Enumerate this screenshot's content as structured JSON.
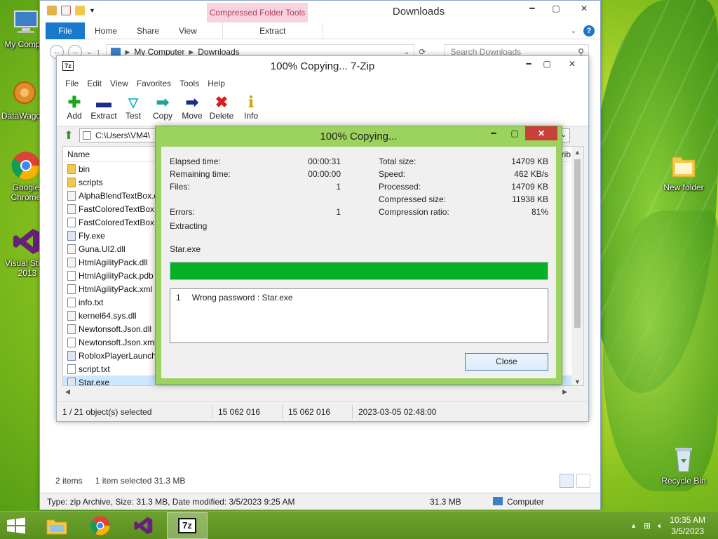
{
  "desktop": {
    "icons": [
      {
        "label": "My Comp..."
      },
      {
        "label": "DataWago..."
      },
      {
        "label": "Google Chrome"
      },
      {
        "label": "Visual Stu... 2013"
      },
      {
        "label": "New folder"
      },
      {
        "label": "Recycle Bin"
      }
    ]
  },
  "explorer": {
    "title": "Downloads",
    "context_tab": "Compressed Folder Tools",
    "tabs": {
      "file": "File",
      "home": "Home",
      "share": "Share",
      "view": "View",
      "extract": "Extract"
    },
    "breadcrumb": {
      "root": "My Computer",
      "folder": "Downloads"
    },
    "search_placeholder": "Search Downloads",
    "status": {
      "items": "2 items",
      "selected": "1 item selected  31.3 MB"
    },
    "details": {
      "info": "Type: zip Archive, Size: 31.3 MB, Date modified: 3/5/2023 9:25 AM",
      "size": "31.3 MB",
      "location": "Computer"
    }
  },
  "zip": {
    "title": "100% Copying... 7-Zip",
    "menu": [
      "File",
      "Edit",
      "View",
      "Favorites",
      "Tools",
      "Help"
    ],
    "toolbar": {
      "add": "Add",
      "extract": "Extract",
      "test": "Test",
      "copy": "Copy",
      "move": "Move",
      "delete": "Delete",
      "info": "Info"
    },
    "path": "C:\\Users\\VM4\\",
    "column_name": "Name",
    "column_right": "trib",
    "files": [
      {
        "name": "bin",
        "type": "folder"
      },
      {
        "name": "scripts",
        "type": "folder"
      },
      {
        "name": "AlphaBlendTextBox.d",
        "type": "dll"
      },
      {
        "name": "FastColoredTextBox.c",
        "type": "dll"
      },
      {
        "name": "FastColoredTextBox.x",
        "type": "file"
      },
      {
        "name": "Fly.exe",
        "type": "exe"
      },
      {
        "name": "Guna.UI2.dll",
        "type": "dll"
      },
      {
        "name": "HtmlAgilityPack.dll",
        "type": "dll"
      },
      {
        "name": "HtmlAgilityPack.pdb",
        "type": "file"
      },
      {
        "name": "HtmlAgilityPack.xml",
        "type": "file"
      },
      {
        "name": "info.txt",
        "type": "file"
      },
      {
        "name": "kernel64.sys.dll",
        "type": "dll"
      },
      {
        "name": "Newtonsoft.Json.dll",
        "type": "dll"
      },
      {
        "name": "Newtonsoft.Json.xml",
        "type": "file"
      },
      {
        "name": "RobloxPlayerLaunche",
        "type": "exe"
      },
      {
        "name": "script.txt",
        "type": "file"
      },
      {
        "name": "Star.exe",
        "type": "exe",
        "selected": true
      }
    ],
    "statusbar": {
      "selection": "1 / 21 object(s) selected",
      "size": "15 062 016",
      "packed": "15 062 016",
      "modified": "2023-03-05 02:48:00"
    }
  },
  "progress": {
    "title": "100% Copying...",
    "left": {
      "elapsed_label": "Elapsed time:",
      "elapsed": "00:00:31",
      "remaining_label": "Remaining time:",
      "remaining": "00:00:00",
      "files_label": "Files:",
      "files": "1",
      "errors_label": "Errors:",
      "errors": "1"
    },
    "right": {
      "total_label": "Total size:",
      "total": "14709 KB",
      "speed_label": "Speed:",
      "speed": "462 KB/s",
      "processed_label": "Processed:",
      "processed": "14709 KB",
      "compressed_label": "Compressed size:",
      "compressed": "11938 KB",
      "ratio_label": "Compression ratio:",
      "ratio": "81%"
    },
    "operation": "Extracting",
    "current_file": "Star.exe",
    "progress_percent": 100,
    "messages": [
      {
        "num": "1",
        "text": "Wrong password : Star.exe"
      }
    ],
    "close_label": "Close"
  },
  "taskbar": {
    "time": "10:35 AM",
    "date": "3/5/2023"
  },
  "colors": {
    "progress_fill": "#06b025",
    "dialog_frame": "#9cd35f",
    "ribbon_file": "#1979ca",
    "context_tab": "#f7d3de"
  }
}
